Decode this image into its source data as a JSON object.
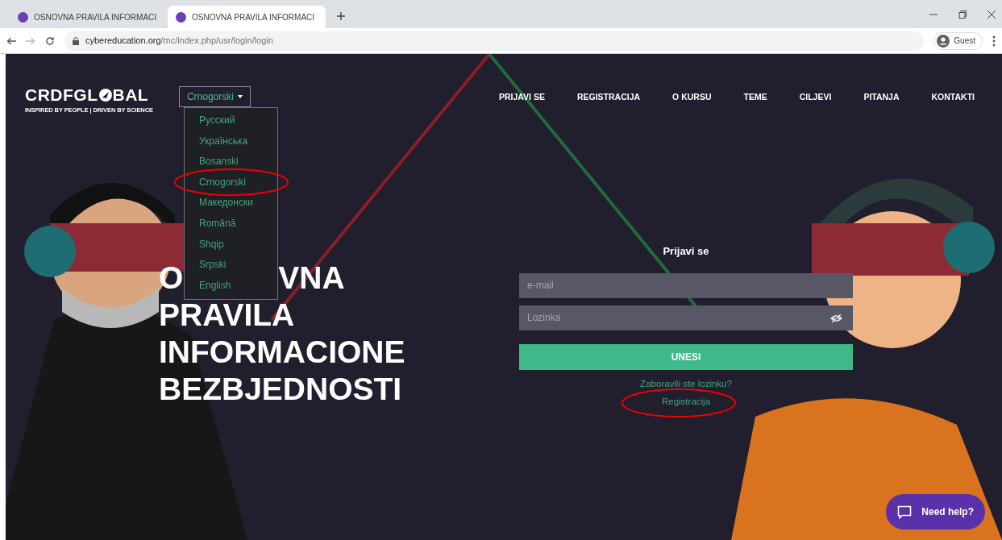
{
  "browser": {
    "tabs": [
      {
        "title": "OSNOVNA PRAVILA INFORMACI",
        "selected": false
      },
      {
        "title": "OSNOVNA PRAVILA INFORMACI",
        "selected": true
      }
    ],
    "url_host": "cybereducation.org",
    "url_path": "/mc/index.php/usr/login/login",
    "profile": "Guest"
  },
  "header": {
    "logo": "CRDFGL",
    "logo_rest": "BAL",
    "tagline": "INSPIRED BY PEOPLE | DRIVEN BY SCIENCE",
    "language": "Crnogorski",
    "language_menu": [
      "Русский",
      "Українська",
      "Bosanski",
      "Crnogorski",
      "Македонски",
      "Română",
      "Shqip",
      "Srpski",
      "English"
    ],
    "nav": [
      "PRIJAVI SE",
      "REGISTRACIJA",
      "O KURSU",
      "TEME",
      "CILJEVI",
      "PITANJA",
      "KONTAKTI"
    ]
  },
  "hero": {
    "title_first_parts": [
      "O",
      "VNA"
    ],
    "title_lines": [
      "PRAVILA",
      "INFORMACIONE",
      "BEZBJEDNOSTI"
    ]
  },
  "login": {
    "heading": "Prijavi se",
    "email_placeholder": "e-mail",
    "password_placeholder": "Lozinka",
    "submit": "UNESI",
    "forgot": "Zaboravili ste lozinku?",
    "register": "Registracija"
  },
  "help": "Need help?"
}
